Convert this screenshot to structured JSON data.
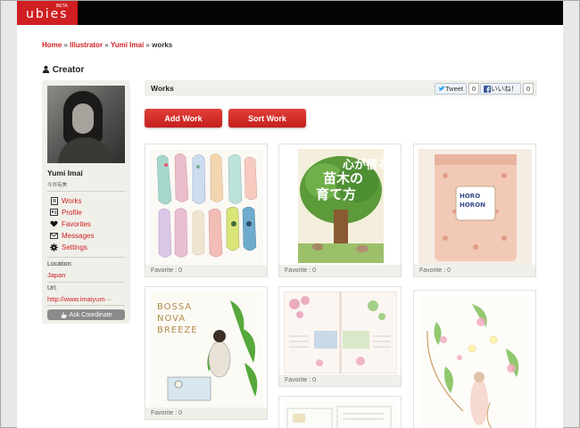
{
  "app": {
    "logo": "ubies",
    "beta": "BETA"
  },
  "breadcrumb": {
    "home": "Home",
    "illustrator": "Illustrator",
    "artist": "Yumi Imai",
    "current": "works",
    "sep": "»"
  },
  "sidebar": {
    "heading": "Creator",
    "name": "Yumi Imai",
    "name_jp": "今井有美",
    "menu": [
      {
        "label": "Works",
        "icon": "document-icon"
      },
      {
        "label": "Profile",
        "icon": "profile-card-icon"
      },
      {
        "label": "Favorites",
        "icon": "heart-icon"
      },
      {
        "label": "Messages",
        "icon": "envelope-icon"
      },
      {
        "label": "Settings",
        "icon": "gear-icon"
      }
    ],
    "location_label": "Location:",
    "location_value": "Japan",
    "url_label": "Url:",
    "url_value": "http://www.imaiyum···",
    "ask_button": "Ask Coordinate"
  },
  "works": {
    "title": "Works",
    "tweet_label": "Tweet",
    "tweet_count": "0",
    "like_label": "いいね！",
    "like_count": "0",
    "add_button": "Add Work",
    "sort_button": "Sort Work"
  },
  "cards": [
    {
      "fav": "Favorite : 0",
      "art": "shoes-illustration"
    },
    {
      "fav": "Favorite : 0",
      "art": "tree-book-cover",
      "cover_text": "心が宿る 苗木の 育て方"
    },
    {
      "fav": "Favorite : 0",
      "art": "horohoron-package",
      "pkg_title": "HORO HORON"
    },
    {
      "fav": "Favorite : 0",
      "art": "bossa-nova-cover",
      "cover_text": "BOSSA NOVA BREEZE"
    },
    {
      "fav": "Favorite : 0",
      "art": "magazine-spread"
    },
    {
      "fav": "",
      "art": "floral-girl-illustration"
    },
    {
      "fav": "",
      "art": "sketch-partial"
    }
  ],
  "colors": {
    "accent": "#cf1f22",
    "topbar": "#050505",
    "panel": "#f0f0ea"
  }
}
